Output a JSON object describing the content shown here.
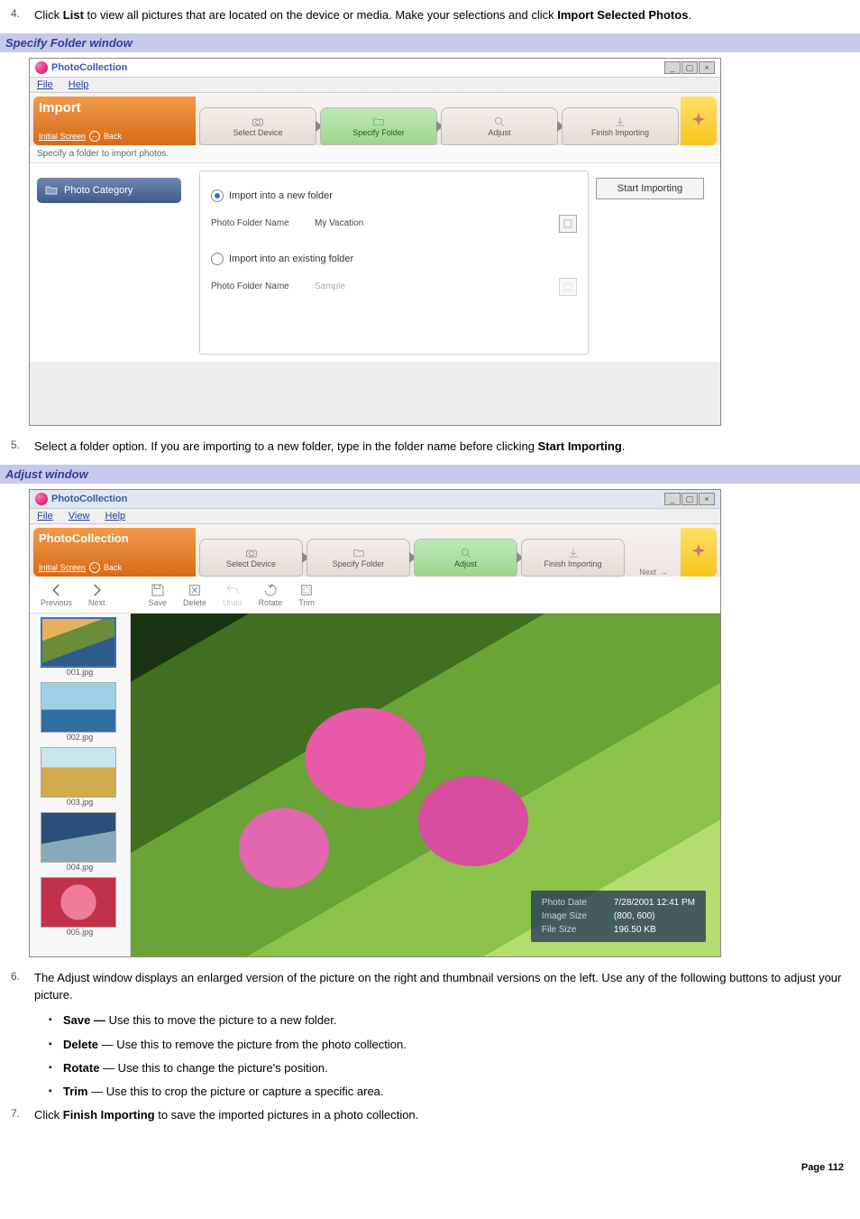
{
  "steps": {
    "s4_num": "4.",
    "s4_a": "Click ",
    "s4_b": "List",
    "s4_c": " to view all pictures that are located on the device or media. Make your selections and click ",
    "s4_d": "Import Selected Photos",
    "s4_e": ".",
    "s5_num": "5.",
    "s5_a": "Select a folder option. If you are importing to a new folder, type in the folder name before clicking ",
    "s5_b": "Start Importing",
    "s5_c": ".",
    "s6_num": "6.",
    "s6_a": "The Adjust window displays an enlarged version of the picture on the right and thumbnail versions on the left. Use any of the following buttons to adjust your picture.",
    "s7_num": "7.",
    "s7_a": "Click ",
    "s7_b": "Finish Importing",
    "s7_c": " to save the imported pictures in a photo collection."
  },
  "sections": {
    "specify": "Specify Folder window",
    "adjust": "Adjust window"
  },
  "bullets": {
    "save_t": "Save —",
    "save_d": " Use this to move the picture to a new folder.",
    "delete_t": "Delete",
    "delete_d": " — Use this to remove the picture from the photo collection.",
    "rotate_t": "Rotate",
    "rotate_d": " — Use this to change the picture's position.",
    "trim_t": "Trim",
    "trim_d": " — Use this to crop the picture or capture a specific area."
  },
  "app": {
    "title": "PhotoCollection",
    "menu_file": "File",
    "menu_view": "View",
    "menu_help": "Help",
    "banner_title": "Import",
    "banner_title2": "PhotoCollection",
    "initial_screen": "Initial Screen",
    "back": "Back",
    "next_btn": "Next",
    "tab_select": "Select Device",
    "tab_specify": "Specify Folder",
    "tab_adjust": "Adjust",
    "tab_finish": "Finish Importing",
    "instruction": "Specify a folder to import photos.",
    "photo_category": "Photo Category",
    "radio_new": "Import into a new folder",
    "radio_existing": "Import into an existing folder",
    "field_label": "Photo Folder Name",
    "field_new_value": "My Vacation",
    "field_existing_placeholder": "Sample",
    "start_btn": "Start Importing",
    "tool_prev": "Previous",
    "tool_next": "Next",
    "tool_save": "Save",
    "tool_delete": "Delete",
    "tool_undo": "Undo",
    "tool_rotate": "Rotate",
    "tool_trim": "Trim",
    "thumbs": [
      "001.jpg",
      "002.jpg",
      "003.jpg",
      "004.jpg",
      "005.jpg"
    ],
    "overlay": {
      "photo_date_l": "Photo Date",
      "photo_date_v": "7/28/2001 12:41 PM",
      "image_size_l": "Image Size",
      "image_size_v": "(800, 600)",
      "file_size_l": "File Size",
      "file_size_v": "196.50 KB"
    }
  },
  "page_num": "Page 112"
}
